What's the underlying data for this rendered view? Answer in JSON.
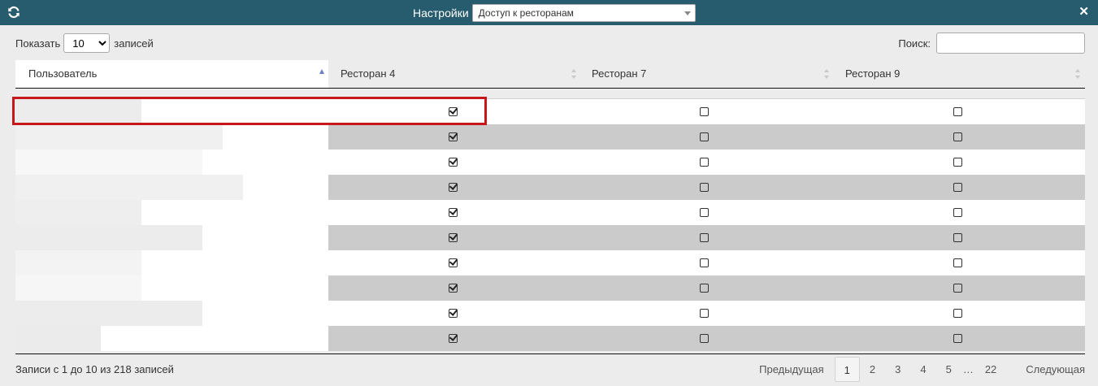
{
  "titlebar": {
    "refresh_icon": "refresh-icon",
    "title": "Настройки",
    "dropdown_value": "Доступ к ресторанам",
    "close_icon": "close-icon",
    "color": "#275c6e"
  },
  "length": {
    "prefix": "Показать",
    "value": "10",
    "suffix": "записей"
  },
  "search": {
    "label": "Поиск:",
    "value": ""
  },
  "table": {
    "columns": [
      "Пользователь",
      "Ресторан 4",
      "Ресторан 7",
      "Ресторан 9"
    ],
    "rows": [
      {
        "r4": true,
        "r7": false,
        "r9": false
      },
      {
        "r4": true,
        "r7": false,
        "r9": false
      },
      {
        "r4": true,
        "r7": false,
        "r9": false
      },
      {
        "r4": true,
        "r7": false,
        "r9": false
      },
      {
        "r4": true,
        "r7": false,
        "r9": false
      },
      {
        "r4": true,
        "r7": false,
        "r9": false
      },
      {
        "r4": true,
        "r7": false,
        "r9": false
      },
      {
        "r4": true,
        "r7": false,
        "r9": false
      },
      {
        "r4": true,
        "r7": false,
        "r9": false
      },
      {
        "r4": true,
        "r7": false,
        "r9": false
      }
    ]
  },
  "footer": {
    "info": "Записи с 1 до 10 из 218 записей",
    "prev": "Предыдущая",
    "pages": [
      "1",
      "2",
      "3",
      "4",
      "5"
    ],
    "ellipsis": "…",
    "last_page": "22",
    "next": "Следующая",
    "current_page": "1"
  },
  "highlight_color": "#c8161d"
}
